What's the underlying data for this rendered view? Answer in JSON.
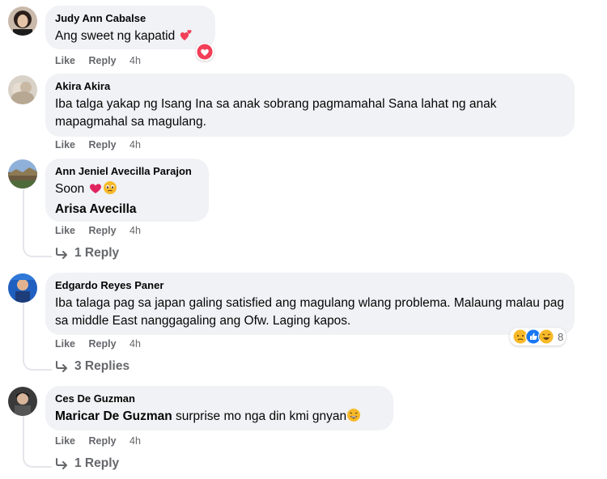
{
  "comments": [
    {
      "author": "Judy Ann Cabalse",
      "text": "Ang sweet ng kapatid",
      "like": "Like",
      "reply": "Reply",
      "time": "4h"
    },
    {
      "author": "Akira Akira",
      "text": "Iba talga yakap ng Isang Ina sa anak sobrang pagmamahal Sana lahat ng anak mapagmahal sa magulang.",
      "like": "Like",
      "reply": "Reply",
      "time": "4h"
    },
    {
      "author": "Ann Jeniel Avecilla Parajon",
      "text": "Soon",
      "mention": "Arisa Avecilla",
      "like": "Like",
      "reply": "Reply",
      "time": "4h",
      "replies_label": "1 Reply"
    },
    {
      "author": "Edgardo Reyes Paner",
      "text": "Iba talaga pag sa japan galing satisfied ang magulang wlang problema. Malaung malau pag sa middle East nanggagaling ang Ofw. Laging kapos.",
      "reaction_count": "8",
      "like": "Like",
      "reply": "Reply",
      "time": "4h",
      "replies_label": "3 Replies"
    },
    {
      "author": "Ces De Guzman",
      "mention": "Maricar De Guzman",
      "text": " surprise mo nga din kmi gnyan",
      "like": "Like",
      "reply": "Reply",
      "time": "4h",
      "replies_label": "1 Reply"
    }
  ],
  "colors": {
    "bubble": "#f0f2f5",
    "meta": "#65676b",
    "text": "#050505",
    "love": "#f33e58",
    "like": "#1877f2",
    "haha": "#f7b928"
  }
}
